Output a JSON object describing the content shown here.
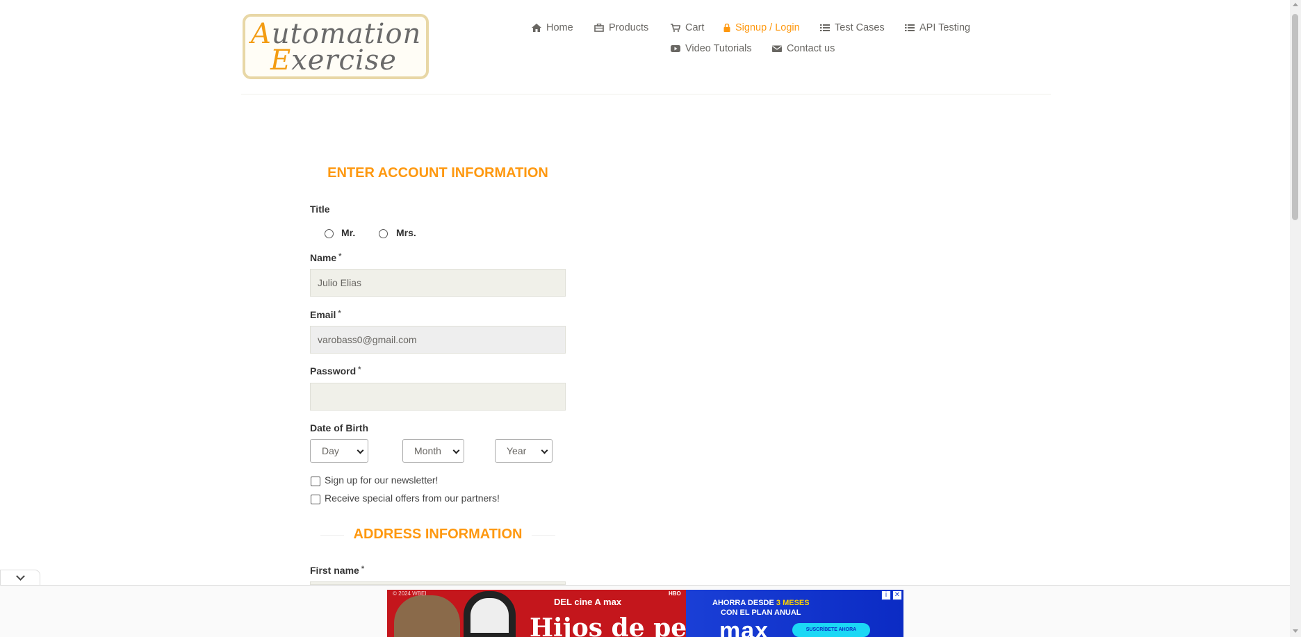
{
  "logo": {
    "line1_cap": "A",
    "line1_rest": "utomation",
    "line2_cap": "E",
    "line2_rest": "xercise"
  },
  "nav": {
    "items": [
      {
        "label": "Home",
        "icon": "home-icon"
      },
      {
        "label": "Products",
        "icon": "products-icon"
      },
      {
        "label": "Cart",
        "icon": "cart-icon"
      },
      {
        "label": "Signup / Login",
        "icon": "lock-icon",
        "active": true
      },
      {
        "label": "Test Cases",
        "icon": "list-icon"
      },
      {
        "label": "API Testing",
        "icon": "list-icon"
      },
      {
        "label": "Video Tutorials",
        "icon": "youtube-icon"
      },
      {
        "label": "Contact us",
        "icon": "envelope-icon"
      }
    ],
    "active_color": "#fe980f"
  },
  "account": {
    "title": "ENTER ACCOUNT INFORMATION",
    "title_label": "Title",
    "title_options": [
      "Mr.",
      "Mrs."
    ],
    "name_label": "Name",
    "name_value": "Julio Elias",
    "email_label": "Email",
    "email_value": "varobass0@gmail.com",
    "password_label": "Password",
    "password_value": "",
    "dob_label": "Date of Birth",
    "dob_day": "Day",
    "dob_month": "Month",
    "dob_year": "Year",
    "newsletter_label": "Sign up for our newsletter!",
    "offers_label": "Receive special offers from our partners!",
    "required_mark": "*"
  },
  "address": {
    "title": "ADDRESS INFORMATION",
    "first_name_label": "First name"
  },
  "ad": {
    "copyright": "© 2024 WBEI",
    "network": "HBO",
    "cine_line": "DEL cine A max",
    "movie_title": "Hijos de perra",
    "offer_line1": "AHORRA DESDE",
    "offer_highlight": "3 MESES",
    "offer_line2": "CON EL PLAN ANUAL",
    "brand": "max",
    "cta": "SUSCRÍBETE AHORA"
  },
  "colors": {
    "accent": "#fe980f",
    "input_bg": "#f0f0e9",
    "text": "#696763"
  }
}
